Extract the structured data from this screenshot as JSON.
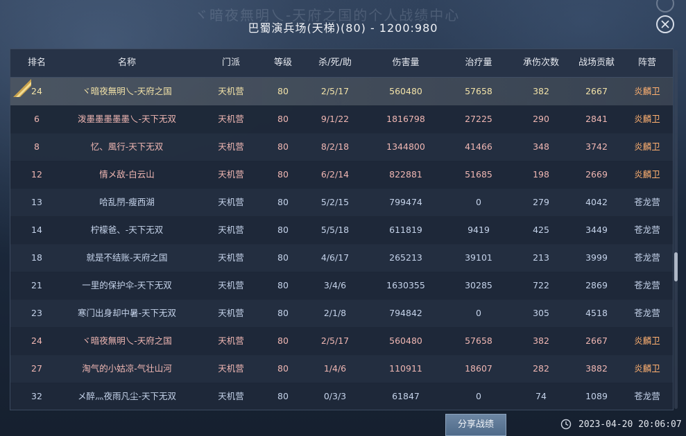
{
  "window": {
    "title": "巴蜀演兵场(天梯)(80) - 1200:980",
    "background_title": "ヾ暗夜無明乀-天府之国的个人战绩中心"
  },
  "colors": {
    "red_team_text": "#f0b7b3",
    "blue_team_text": "#c5d3ea",
    "self_text": "#f2e2a8",
    "faction_red": "#ffb070"
  },
  "table": {
    "headers": [
      "排名",
      "名称",
      "门派",
      "等级",
      "杀/死/助",
      "伤害量",
      "治疗量",
      "承伤次数",
      "战场贡献",
      "阵营"
    ],
    "rows": [
      {
        "rank": "24",
        "name": "ヾ暗夜無明乀-天府之国",
        "school": "天机营",
        "level": "80",
        "kda": "2/5/17",
        "damage": "560480",
        "heal": "57658",
        "hits": "382",
        "contrib": "2667",
        "faction": "炎麟卫",
        "team": "self",
        "badge": "MVP-badge-icon"
      },
      {
        "rank": "6",
        "name": "泼墨墨墨墨墨乀-天下无双",
        "school": "天机营",
        "level": "80",
        "kda": "9/1/22",
        "damage": "1816798",
        "heal": "27225",
        "hits": "290",
        "contrib": "2841",
        "faction": "炎麟卫",
        "team": "red"
      },
      {
        "rank": "8",
        "name": "忆、風行-天下无双",
        "school": "天机营",
        "level": "80",
        "kda": "8/2/18",
        "damage": "1344800",
        "heal": "41466",
        "hits": "348",
        "contrib": "3742",
        "faction": "炎麟卫",
        "team": "red"
      },
      {
        "rank": "12",
        "name": "情メ敌-白云山",
        "school": "天机营",
        "level": "80",
        "kda": "6/2/14",
        "damage": "822881",
        "heal": "51685",
        "hits": "198",
        "contrib": "2669",
        "faction": "炎麟卫",
        "team": "red"
      },
      {
        "rank": "13",
        "name": "哈乱閅-瘦西湖",
        "school": "天机营",
        "level": "80",
        "kda": "5/2/15",
        "damage": "799474",
        "heal": "0",
        "hits": "279",
        "contrib": "4042",
        "faction": "苍龙营",
        "team": "blue"
      },
      {
        "rank": "14",
        "name": "柠檬爸、-天下无双",
        "school": "天机营",
        "level": "80",
        "kda": "5/5/18",
        "damage": "611819",
        "heal": "9419",
        "hits": "425",
        "contrib": "3449",
        "faction": "苍龙营",
        "team": "blue"
      },
      {
        "rank": "18",
        "name": "就是不结账-天府之国",
        "school": "天机营",
        "level": "80",
        "kda": "4/6/17",
        "damage": "265213",
        "heal": "39101",
        "hits": "213",
        "contrib": "3999",
        "faction": "苍龙营",
        "team": "blue"
      },
      {
        "rank": "21",
        "name": "一里的保护伞-天下无双",
        "school": "天机营",
        "level": "80",
        "kda": "3/4/6",
        "damage": "1630355",
        "heal": "30285",
        "hits": "722",
        "contrib": "2869",
        "faction": "苍龙营",
        "team": "blue"
      },
      {
        "rank": "23",
        "name": "寒门出身却中暑-天下无双",
        "school": "天机营",
        "level": "80",
        "kda": "2/1/8",
        "damage": "794842",
        "heal": "0",
        "hits": "305",
        "contrib": "4518",
        "faction": "苍龙营",
        "team": "blue"
      },
      {
        "rank": "24",
        "name": "ヾ暗夜無明乀-天府之国",
        "school": "天机营",
        "level": "80",
        "kda": "2/5/17",
        "damage": "560480",
        "heal": "57658",
        "hits": "382",
        "contrib": "2667",
        "faction": "炎麟卫",
        "team": "red"
      },
      {
        "rank": "27",
        "name": "淘气的小姑凉-气壮山河",
        "school": "天机营",
        "level": "80",
        "kda": "1/4/6",
        "damage": "110911",
        "heal": "18607",
        "hits": "282",
        "contrib": "3882",
        "faction": "炎麟卫",
        "team": "red"
      },
      {
        "rank": "32",
        "name": "メ醉灬夜雨凡尘-天下无双",
        "school": "天机营",
        "level": "80",
        "kda": "0/3/3",
        "damage": "61847",
        "heal": "0",
        "hits": "74",
        "contrib": "1089",
        "faction": "苍龙营",
        "team": "blue"
      }
    ]
  },
  "footer": {
    "share_label": "分享战绩",
    "timestamp": "2023-04-20 20:06:07"
  }
}
